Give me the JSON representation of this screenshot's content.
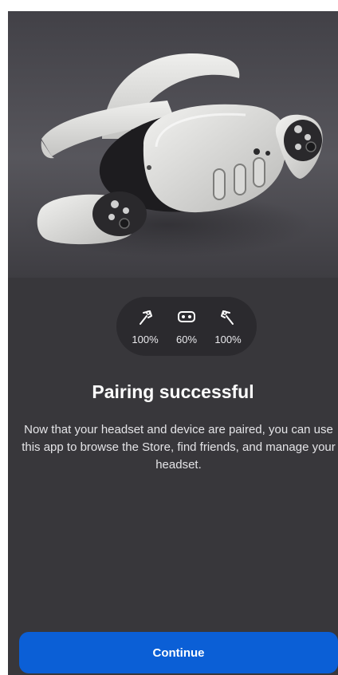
{
  "hero": {
    "image_name": "headset-and-controllers-image"
  },
  "battery": {
    "items": [
      {
        "icon": "left-controller-icon",
        "value": "100%"
      },
      {
        "icon": "headset-icon",
        "value": "60%"
      },
      {
        "icon": "right-controller-icon",
        "value": "100%"
      }
    ]
  },
  "main": {
    "title": "Pairing successful",
    "description": "Now that your headset and device are paired, you can use this app to browse the Store, find friends, and manage your headset."
  },
  "footer": {
    "continue_label": "Continue"
  },
  "colors": {
    "background": "#38373b",
    "pill": "#2b2a2e",
    "primary_button": "#0b5fd6"
  }
}
